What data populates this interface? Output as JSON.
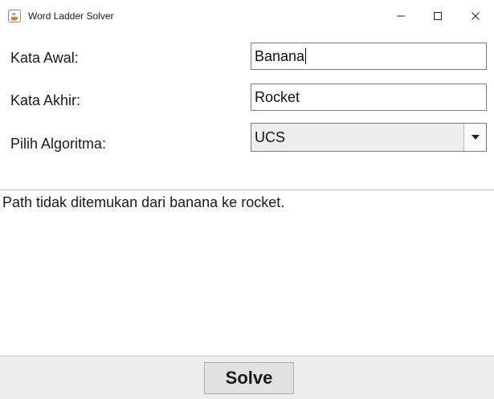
{
  "window": {
    "title": "Word Ladder Solver",
    "icon": "java-cup-icon",
    "controls": [
      "minimize-icon",
      "maximize-icon",
      "close-icon"
    ]
  },
  "form": {
    "start_label": "Kata Awal:",
    "start_value": "Banana",
    "end_label": "Kata Akhir:",
    "end_value": "Rocket",
    "algo_label": "Pilih Algoritma:",
    "algo_selected": "UCS"
  },
  "output": {
    "message": "Path tidak ditemukan dari banana ke rocket."
  },
  "footer": {
    "solve_label": "Solve"
  },
  "colors": {
    "footer_bg": "#ededed",
    "select_bg": "#eeeeee",
    "button_bg": "#e1e1e1",
    "border": "#7a7a7a"
  }
}
